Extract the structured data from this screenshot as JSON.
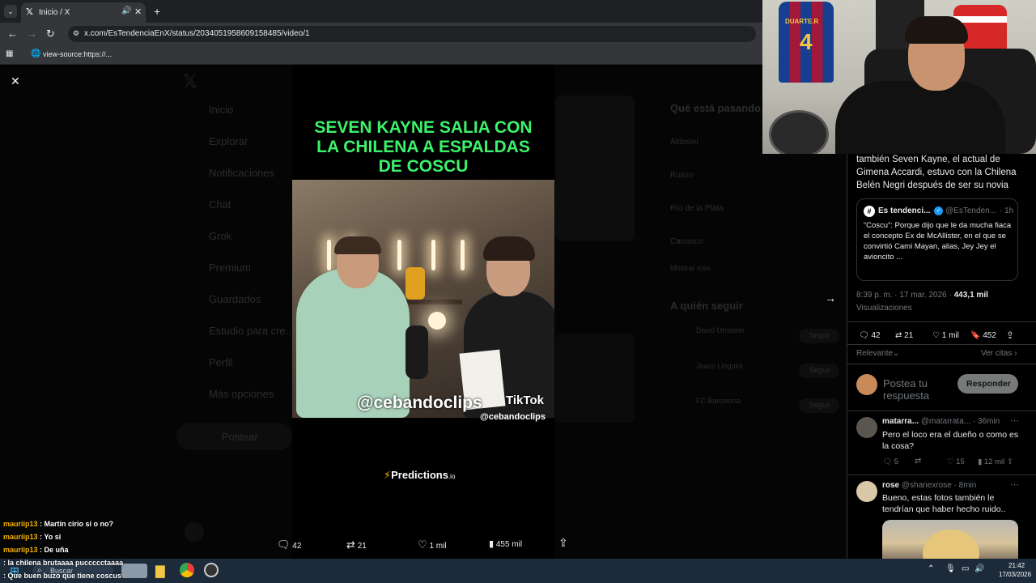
{
  "browser": {
    "tab_title": "Inicio / X",
    "url": "x.com/EsTendenciaEnX/status/2034051958609158485/video/1",
    "bookmark": "view-source:https://..."
  },
  "background_page": {
    "nav": [
      "Inicio",
      "Explorar",
      "Notificaciones",
      "Chat",
      "Grok",
      "Premium",
      "Guardados",
      "Estudio para cre...",
      "Perfil",
      "Más opciones"
    ],
    "post_button": "Postear",
    "trending_header": "Qué está pasando",
    "trends": [
      "Aldosivi",
      "Russo",
      "Río de la Plata",
      "Carrasco"
    ],
    "show_more": "Mostrar más",
    "who_to_follow": "A quién seguir",
    "follow_accounts": [
      "David Ornstein",
      "Joaco Linguini",
      "FC Barcelona"
    ],
    "follow_label": "Seguir"
  },
  "video": {
    "title": "SEVEN KAYNE SALIA CON LA CHILENA A ESPALDAS DE COSCU",
    "watermark": "@cebandoclips",
    "tiktok_label": "TikTok",
    "tiktok_handle": "@cebandoclips",
    "sponsor": "Predictions",
    "sponsor_suffix": ".io"
  },
  "video_actions": {
    "replies": "42",
    "reposts": "21",
    "likes": "1 mil",
    "views": "455 mil"
  },
  "post": {
    "body": "también Seven Kayne, el actual de Gimena Accardi, estuvo con la Chilena Belén Negri después de ser su novia",
    "quote": {
      "name": "Es tendenci...",
      "handle": "@EsTenden...",
      "time": "· 1h",
      "text": "“Coscu”: Porque dijo que le da mucha fiaca el concepto Ex de McAllister, en el que se convirtió Cami Mayan, alias, Jey Jey el avioncito ..."
    },
    "timestamp": "8:39 p. m. · 17 mar. 2026 ·",
    "views_count": "443,1 mil",
    "views_label": "Visualizaciones",
    "stats": {
      "replies": "42",
      "reposts": "21",
      "likes": "1 mil",
      "bookmarks": "452"
    },
    "sort_label": "Relevante",
    "quotes_link": "Ver citas",
    "reply_placeholder": "Postea tu respuesta",
    "reply_button": "Responder"
  },
  "replies": [
    {
      "name": "matarra...",
      "handle": "@matarrata...",
      "time": "· 36min",
      "text": "Pero el loco era el dueño o como es la cosa?",
      "replies": "5",
      "likes": "15",
      "views": "12 mil"
    },
    {
      "name": "rose",
      "handle": "@shanexrose",
      "time": "· 8min",
      "text": "Bueno, estas fotos también le tendrían que haber hecho ruido.."
    }
  ],
  "webcam": {
    "jersey_text": "DUARTE.R",
    "jersey_number": "4"
  },
  "chat": [
    {
      "user": "mauriip13",
      "message": "Martín cirio si o no?"
    },
    {
      "user": "mauriip13",
      "message": "Yo si"
    },
    {
      "user": "mauriip13",
      "message": "De uña"
    },
    {
      "user": "",
      "message": "la chilena brutaaaa puccccctaaaa"
    },
    {
      "user": "",
      "message": "Que buen buzo que tiene coscus"
    }
  ],
  "taskbar": {
    "search_label": "Buscar",
    "time": "21:42",
    "date": "17/03/2026"
  },
  "colors": {
    "video_title": "#3df26b",
    "chat_user": "#f5b400",
    "verified": "#1d9bf0"
  }
}
